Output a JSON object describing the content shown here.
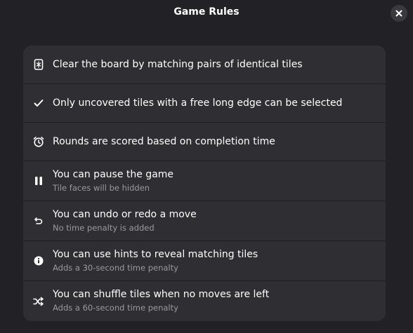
{
  "window": {
    "title": "Game Rules",
    "close_icon": "close-icon"
  },
  "rules": [
    {
      "icon": "tile-icon",
      "title": "Clear the board by matching pairs of identical tiles",
      "subtitle": ""
    },
    {
      "icon": "checkmark-icon",
      "title": "Only uncovered tiles with a free long edge can be selected",
      "subtitle": ""
    },
    {
      "icon": "alarm-icon",
      "title": "Rounds are scored based on completion time",
      "subtitle": ""
    },
    {
      "icon": "pause-icon",
      "title": "You can pause the game",
      "subtitle": "Tile faces will be hidden"
    },
    {
      "icon": "undo-icon",
      "title": "You can undo or redo a move",
      "subtitle": "No time penalty is added"
    },
    {
      "icon": "info-icon",
      "title": "You can use hints to reveal matching tiles",
      "subtitle": "Adds a 30-second time penalty"
    },
    {
      "icon": "shuffle-icon",
      "title": "You can shuffle tiles when no moves are left",
      "subtitle": "Adds a 60-second time penalty"
    }
  ]
}
